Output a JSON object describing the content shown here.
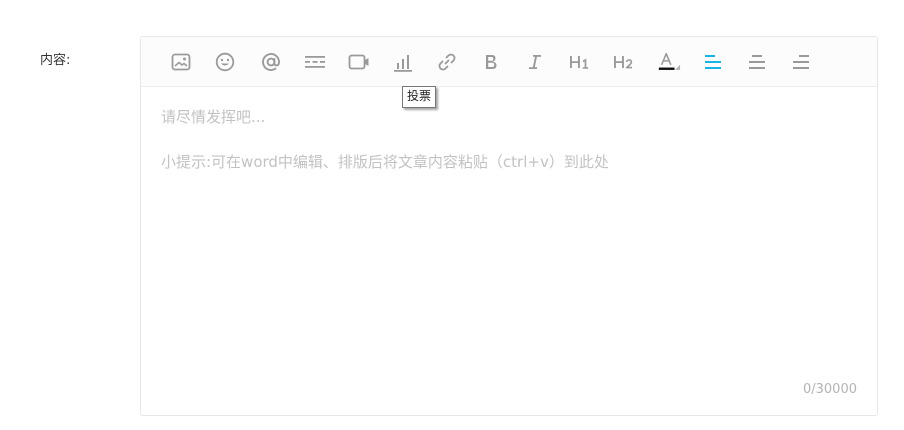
{
  "form": {
    "content_label": "内容:"
  },
  "toolbar": {
    "tooltip": "投票",
    "colors": {
      "icon": "#9a9a9a",
      "active": "#1ab3e6",
      "font_color_bar": "#111111"
    }
  },
  "editor": {
    "placeholder_line1": "请尽情发挥吧...",
    "placeholder_line2": "小提示:可在word中编辑、排版后将文章内容粘贴（ctrl+v）到此处",
    "counter": "0/30000"
  }
}
